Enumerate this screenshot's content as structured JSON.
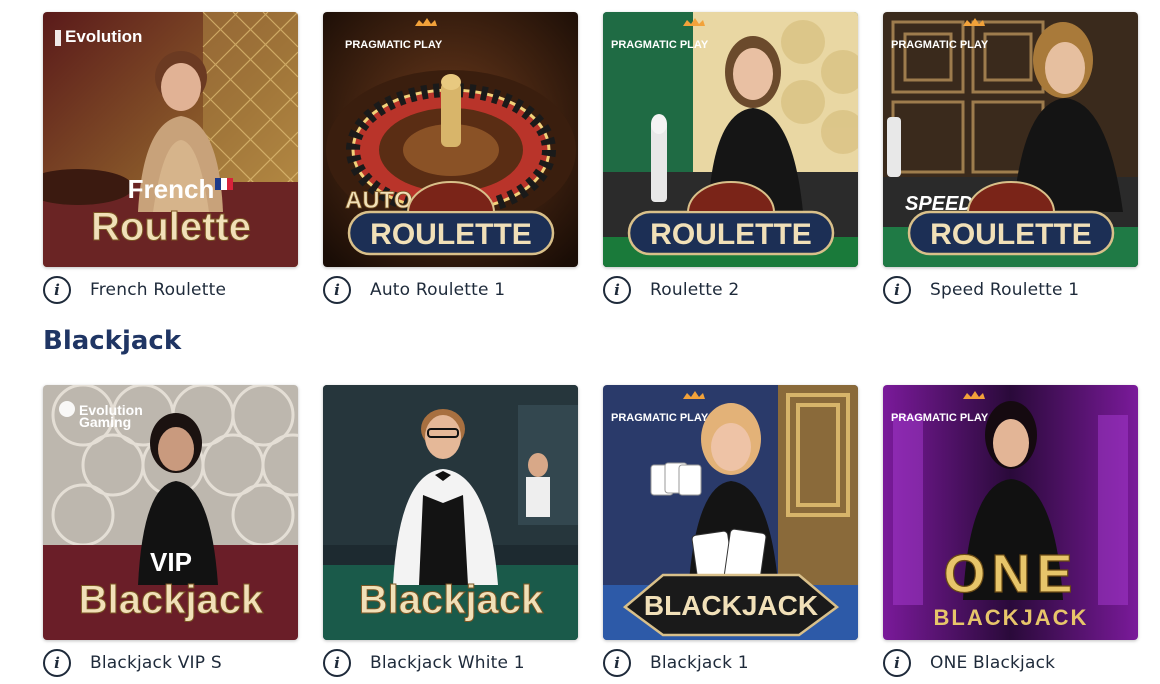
{
  "colors": {
    "text": "#1e2a3a",
    "heading": "#1f3564",
    "gold": "#e8d39a",
    "pill": "#1c2f55"
  },
  "info_icon_glyph": "i",
  "rows": [
    {
      "games": [
        {
          "name": "French Roulette",
          "provider": "Evolution",
          "banner_top": "French",
          "banner_main": "Roulette"
        },
        {
          "name": "Auto Roulette 1",
          "provider": "PRAGMATIC PLAY",
          "banner_top": "AUTO",
          "banner_main": "ROULETTE"
        },
        {
          "name": "Roulette 2",
          "provider": "PRAGMATIC PLAY",
          "banner_top": "",
          "banner_main": "ROULETTE"
        },
        {
          "name": "Speed Roulette 1",
          "provider": "PRAGMATIC PLAY",
          "banner_top": "SPEED",
          "banner_main": "ROULETTE"
        }
      ]
    },
    {
      "section_title": "Blackjack",
      "games": [
        {
          "name": "Blackjack VIP S",
          "provider_line1": "Evolution",
          "provider_line2": "Gaming",
          "banner_top": "VIP",
          "banner_main": "Blackjack"
        },
        {
          "name": "Blackjack White 1",
          "provider": "",
          "banner_top": "",
          "banner_main": "Blackjack"
        },
        {
          "name": "Blackjack 1",
          "provider": "PRAGMATIC PLAY",
          "banner_top": "",
          "banner_main": "BLACKJACK"
        },
        {
          "name": "ONE Blackjack",
          "provider": "PRAGMATIC PLAY",
          "banner_top": "ONE",
          "banner_main": "BLACKJACK"
        }
      ]
    }
  ]
}
